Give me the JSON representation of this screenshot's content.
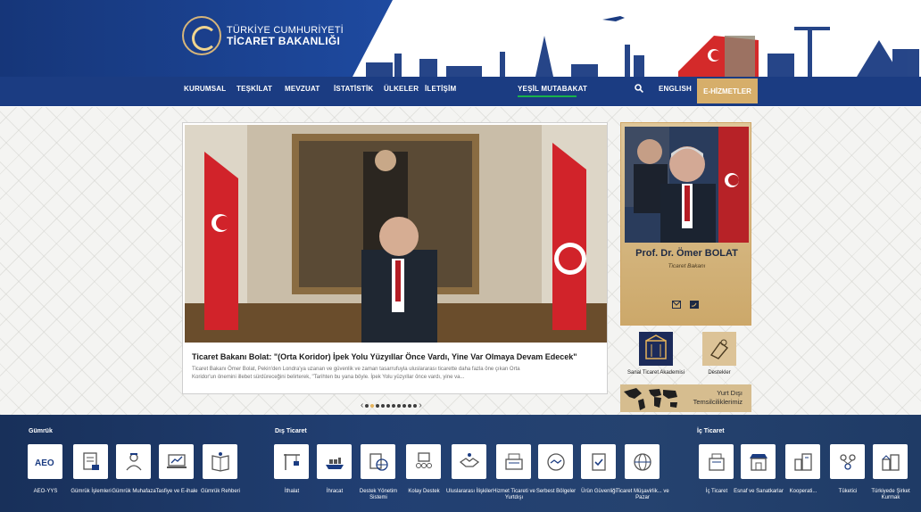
{
  "header": {
    "logo_line1": "TÜRKİYE CUMHURİYETİ",
    "logo_line2": "TİCARET BAKANLIĞI",
    "nav": [
      "KURUMSAL",
      "TEŞKİLAT",
      "MEVZUAT",
      "İSTATİSTİK",
      "ÜLKELER",
      "İLETİŞİM"
    ],
    "green_link": "YEŞİL MUTABAKAT",
    "english": "ENGLISH",
    "e_hizmetler": "E-HİZMETLER",
    "colors": {
      "navy": "#1b3c82",
      "gold": "#d6ae6a",
      "green": "#18b34a"
    }
  },
  "slider": {
    "title": "Ticaret Bakanı Bolat: \"(Orta Koridor) İpek Yolu Yüzyıllar Önce Vardı, Yine Var Olmaya Devam Edecek\"",
    "text": "Ticaret Bakanı Ömer Bolat, Pekin'den Londra'ya uzanan ve güvenlik ve zaman tasarrufuyla uluslararası ticarette daha fazla öne çıkan Orta Koridor'un önemini illebet sürdüreceğini belirterek, \"Tarihten bu yana böyle. İpek Yolu yüzyıllar önce vardı, yine va...",
    "dot_count": 10,
    "active_dot": 1
  },
  "minister": {
    "name": "Prof. Dr. Ömer BOLAT",
    "role": "Ticaret Bakanı"
  },
  "quick_links": {
    "akademi": "Sanal Ticaret Akademisi",
    "destekler": "Destekler",
    "yurt_line1": "Yurt Dışı",
    "yurt_line2": "Temsilciliklerimiz"
  },
  "sections": {
    "gumruk": {
      "title": "Gümrük",
      "items": [
        "AEO-YYS",
        "Gümrük İşlemleri",
        "Gümrük Muhafaza",
        "Tasfiye ve E-ihale",
        "Gümrük Rehberi"
      ]
    },
    "dis_ticaret": {
      "title": "Dış Ticaret",
      "items": [
        "İthalat",
        "İhracat",
        "Destek Yönetim Sistemi",
        "Kolay Destek",
        "Uluslararası İlişkiler",
        "Hizmet Ticareti ve Yurtdışı",
        "Serbest Bölgeler",
        "Ürün Güvenliği",
        "Ticaret Müşavirlik... ve Pazar"
      ]
    },
    "ic_ticaret": {
      "title": "İç Ticaret",
      "items": [
        "İç Ticaret",
        "Esnaf ve Sanatkarlar",
        "Kooperati...",
        "Tüketici",
        "Türkiyede Şirket Kurmak"
      ]
    }
  }
}
